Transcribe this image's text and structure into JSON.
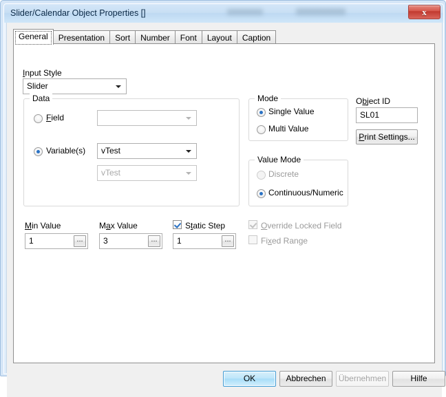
{
  "window": {
    "title": "Slider/Calendar Object Properties []",
    "close_icon": "close-icon",
    "close_label": "x"
  },
  "tabs": [
    {
      "label": "General",
      "active": true
    },
    {
      "label": "Presentation",
      "active": false
    },
    {
      "label": "Sort",
      "active": false
    },
    {
      "label": "Number",
      "active": false
    },
    {
      "label": "Font",
      "active": false
    },
    {
      "label": "Layout",
      "active": false
    },
    {
      "label": "Caption",
      "active": false
    }
  ],
  "general": {
    "input_style": {
      "label": "Input Style",
      "value": "Slider"
    },
    "data_group": {
      "title": "Data",
      "field": {
        "label": "Field",
        "selected": false,
        "combo_value": ""
      },
      "variables": {
        "label": "Variable(s)",
        "selected": true,
        "combo_value": "vTest",
        "combo2_value": "vTest",
        "combo2_disabled": true
      }
    },
    "mode_group": {
      "title": "Mode",
      "options": [
        {
          "label": "Single Value",
          "selected": true
        },
        {
          "label": "Multi Value",
          "selected": false
        }
      ]
    },
    "value_mode_group": {
      "title": "Value Mode",
      "options": [
        {
          "label": "Discrete",
          "selected": false,
          "disabled": true
        },
        {
          "label": "Continuous/Numeric",
          "selected": true,
          "disabled": false
        }
      ]
    },
    "object_id": {
      "label": "Object ID",
      "value": "SL01",
      "print_settings_label": "Print Settings..."
    },
    "min_value": {
      "label": "Min Value",
      "value": "1",
      "ellipsis_label": "..."
    },
    "max_value": {
      "label": "Max Value",
      "value": "3",
      "ellipsis_label": "..."
    },
    "static_step": {
      "label": "Static Step",
      "checked": true,
      "value": "1",
      "ellipsis_label": "..."
    },
    "override_locked_field": {
      "label": "Override Locked Field",
      "checked": true,
      "disabled": true
    },
    "fixed_range": {
      "label": "Fixed Range",
      "checked": false,
      "disabled": true
    }
  },
  "footer": {
    "ok": "OK",
    "cancel": "Abbrechen",
    "apply": "Übernehmen",
    "help": "Hilfe"
  },
  "colors": {
    "accent": "#2a72c4",
    "titlebar": "#c8dff4",
    "close_red": "#c1392f",
    "panel_bg": "#ffffff",
    "dialog_bg": "#f0f0f0"
  }
}
